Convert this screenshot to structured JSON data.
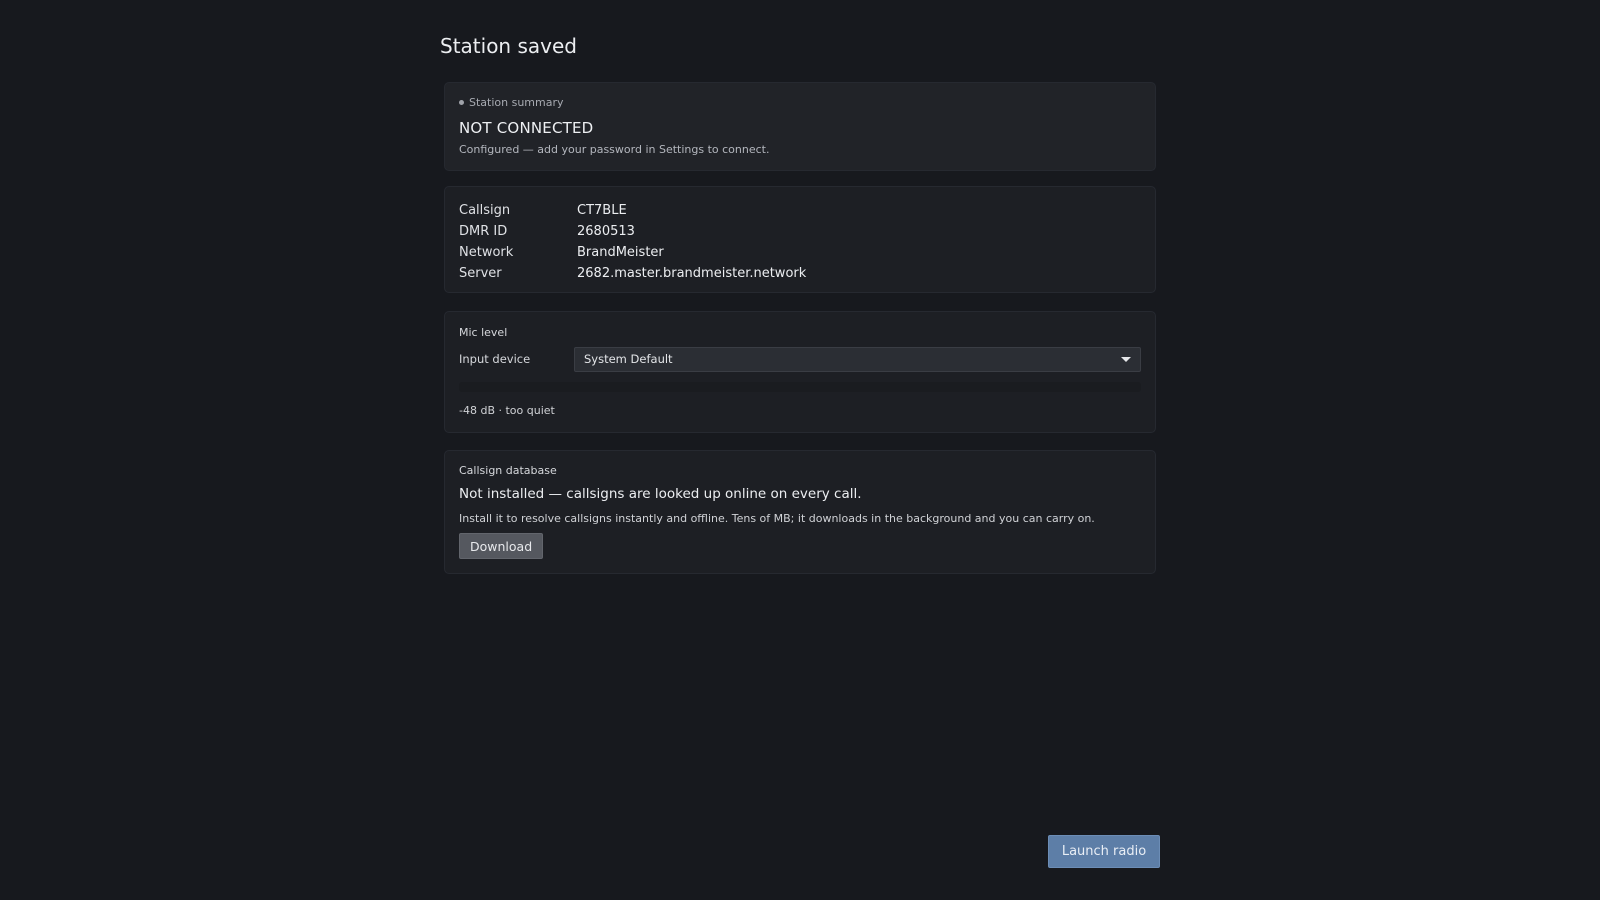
{
  "page": {
    "title": "Station saved"
  },
  "summary": {
    "eyebrow": "Station summary",
    "status": "NOT CONNECTED",
    "hint": "Configured — add your password in Settings to connect."
  },
  "station": {
    "rows": [
      {
        "key": "Callsign",
        "value": "CT7BLE"
      },
      {
        "key": "DMR ID",
        "value": "2680513"
      },
      {
        "key": "Network",
        "value": "BrandMeister"
      },
      {
        "key": "Server",
        "value": "2682.master.brandmeister.network"
      }
    ]
  },
  "mic": {
    "section_label": "Mic level",
    "device_label": "Input device",
    "selected_device": "System Default",
    "level_fraction": 0.0,
    "level_text": "-48 dB · too quiet"
  },
  "callsign_db": {
    "section_label": "Callsign database",
    "headline": "Not installed — callsigns are looked up online on every call.",
    "description": "Install it to resolve callsigns instantly and offline. Tens of MB; it downloads in the background and you can carry on.",
    "download_label": "Download"
  },
  "footer": {
    "launch_label": "Launch radio"
  }
}
